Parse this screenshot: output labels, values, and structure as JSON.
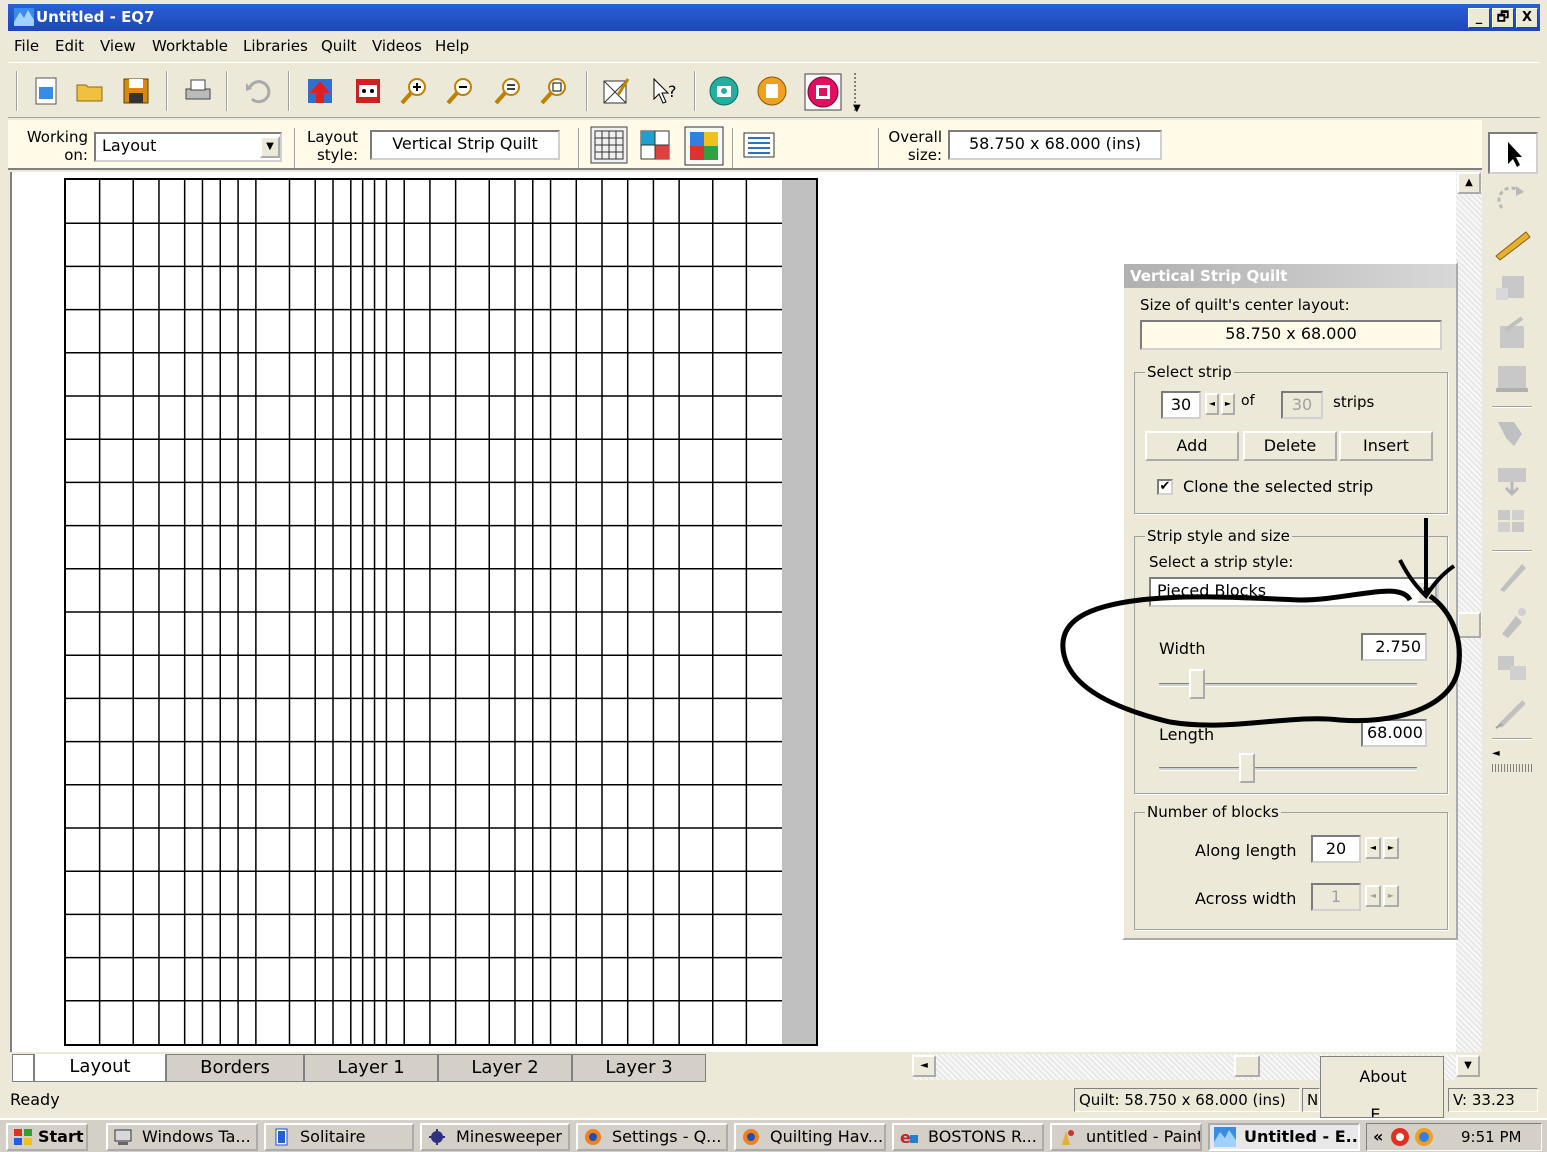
{
  "window": {
    "title": "Untitled - EQ7",
    "minimize": "_",
    "maximize": "🗗",
    "close": "X"
  },
  "menu": [
    "File",
    "Edit",
    "View",
    "Worktable",
    "Libraries",
    "Quilt",
    "Videos",
    "Help"
  ],
  "toolbar": {
    "icons": [
      "new-icon",
      "open-icon",
      "save-icon",
      "print-icon",
      "undo-icon",
      "add-to-sketchbook-icon",
      "view-sketchbook-icon",
      "zoom-in-icon",
      "zoom-out-icon",
      "refresh-icon",
      "fit-to-worktable-icon",
      "quilt-options-icon",
      "help-icon",
      "library-camera-icon",
      "print-preview-icon",
      "lock-icon"
    ]
  },
  "options": {
    "working_on_label": "Working on:",
    "working_on_label1": "Working",
    "working_on_label2": "on:",
    "working_on_value": "Layout",
    "layout_style_label1": "Layout",
    "layout_style_label2": "style:",
    "layout_style_value": "Vertical Strip Quilt",
    "overall_size_label1": "Overall",
    "overall_size_label2": "size:",
    "overall_size_value": "58.750 x 68.000 (ins)"
  },
  "dialog": {
    "title": "Vertical Strip Quilt",
    "size_label": "Size of quilt's center layout:",
    "size_value": "58.750 x 68.000",
    "select_strip_label": "Select strip",
    "strip_number": "30",
    "of_label": "of",
    "total_strips": "30",
    "strips_label": "strips",
    "add_label": "Add",
    "delete_label": "Delete",
    "insert_label": "Insert",
    "clone_label": "Clone the selected strip",
    "clone_checked": true,
    "strip_style_group": "Strip style and size",
    "select_style_label": "Select a strip style:",
    "strip_style_value": "Pieced Blocks",
    "width_label": "Width",
    "width_value": "2.750",
    "length_label": "Length",
    "length_value": "68.000",
    "number_of_blocks_group": "Number of blocks",
    "along_length_label": "Along length",
    "along_length_value": "20",
    "across_width_label": "Across width",
    "across_width_value": "1"
  },
  "tabs": [
    "Layout",
    "Borders",
    "Layer 1",
    "Layer 2",
    "Layer 3"
  ],
  "status": {
    "ready": "Ready",
    "quilt_size": "Quilt: 58.750 x 68.000 (ins)",
    "partial": "N",
    "v": "V: 33.23",
    "about": "About",
    "exit_partial": "E..."
  },
  "taskbar": {
    "start": "Start",
    "tasks": [
      "Windows Ta...",
      "Solitaire",
      "Minesweeper",
      "Settings - Q...",
      "Quilting Hav...",
      "BOSTONS R...",
      "untitled - Paint",
      "Untitled - E..."
    ],
    "tray_chevron": "«",
    "clock": "9:51 PM"
  },
  "colors": {
    "titlebar": "#1c47b8",
    "face": "#ece9d8",
    "options_bg": "#fffbe8",
    "annotation": "#000000"
  }
}
